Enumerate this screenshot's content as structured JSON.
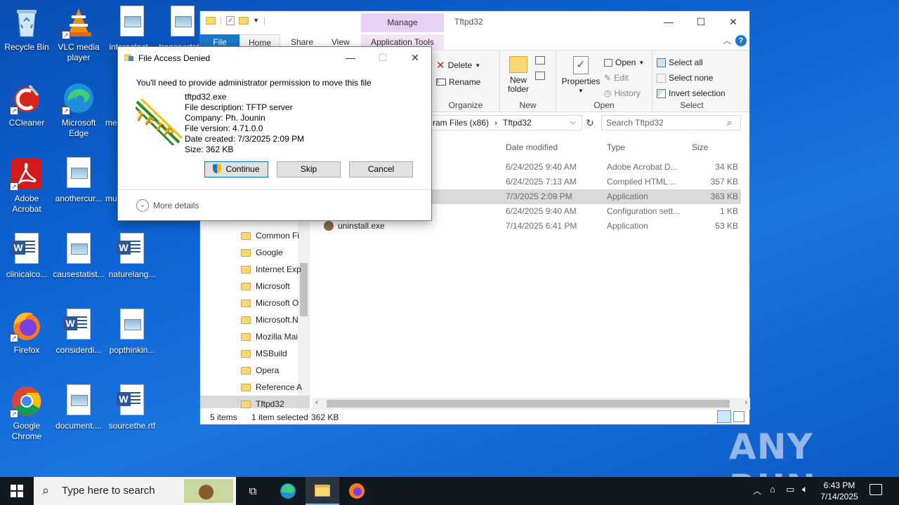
{
  "desktop": {
    "icons": [
      {
        "label": "Recycle Bin",
        "type": "recycle"
      },
      {
        "label": "VLC media player",
        "type": "vlc"
      },
      {
        "label": "interactact...",
        "type": "doc"
      },
      {
        "label": "transportat...",
        "type": "doc"
      },
      {
        "label": "CCleaner",
        "type": "ccleaner"
      },
      {
        "label": "Microsoft Edge",
        "type": "edge"
      },
      {
        "label": "me...",
        "type": "doc"
      },
      {
        "label": "Adobe Acrobat",
        "type": "acrobat"
      },
      {
        "label": "anothercur...",
        "type": "doc"
      },
      {
        "label": "mu...",
        "type": "doc"
      },
      {
        "label": "clinicalco...",
        "type": "word"
      },
      {
        "label": "causestatist...",
        "type": "doc"
      },
      {
        "label": "naturelang...",
        "type": "word"
      },
      {
        "label": "Firefox",
        "type": "firefox"
      },
      {
        "label": "considerdi...",
        "type": "word"
      },
      {
        "label": "popthinkin...",
        "type": "doc"
      },
      {
        "label": "Google Chrome",
        "type": "chrome"
      },
      {
        "label": "document....",
        "type": "doc"
      },
      {
        "label": "sourcethe.rtf",
        "type": "word"
      }
    ]
  },
  "explorer": {
    "title": "Tftpd32",
    "manage_tab": "Manage",
    "tabs": {
      "file": "File",
      "home": "Home",
      "share": "Share",
      "view": "View",
      "app_tools": "Application Tools"
    },
    "ribbon": {
      "delete": "Delete",
      "rename": "Rename",
      "organize": "Organize",
      "new_folder": "New folder",
      "new_group": "New",
      "properties": "Properties",
      "open": "Open",
      "edit": "Edit",
      "history": "History",
      "open_group": "Open",
      "select_all": "Select all",
      "select_none": "Select none",
      "invert_selection": "Invert selection",
      "select_group": "Select"
    },
    "address": {
      "path_partial": "ram Files (x86)",
      "current": "Tftpd32"
    },
    "search_placeholder": "Search Tftpd32",
    "columns": {
      "date": "Date modified",
      "type": "Type",
      "size": "Size"
    },
    "files": [
      {
        "name": "",
        "date": "6/24/2025 9:40 AM",
        "type": "Adobe Acrobat D...",
        "size": "34 KB",
        "selected": false
      },
      {
        "name": "",
        "date": "6/24/2025 7:13 AM",
        "type": "Compiled HTML ...",
        "size": "357 KB",
        "selected": false
      },
      {
        "name": "",
        "date": "7/3/2025 2:09 PM",
        "type": "Application",
        "size": "363 KB",
        "selected": true
      },
      {
        "name": "",
        "date": "6/24/2025 9:40 AM",
        "type": "Configuration sett...",
        "size": "1 KB",
        "selected": false
      },
      {
        "name": "uninstall.exe",
        "date": "7/14/2025 6:41 PM",
        "type": "Application",
        "size": "53 KB",
        "selected": false
      }
    ],
    "nav_items": [
      "Common Fi",
      "Google",
      "Internet Exp",
      "Microsoft",
      "Microsoft O",
      "Microsoft.N",
      "Mozilla Mai",
      "MSBuild",
      "Opera",
      "Reference A",
      "Tftpd32"
    ],
    "status": {
      "count": "5 items",
      "selected": "1 item selected",
      "size": "362 KB"
    }
  },
  "dialog": {
    "title": "File Access Denied",
    "message": "You'll need to provide administrator permission to move this file",
    "file_name": "tftpd32.exe",
    "description": "File description: TFTP server",
    "company": "Company: Ph. Jounin",
    "version": "File version: 4.71.0.0",
    "created": "Date created: 7/3/2025 2:09 PM",
    "size": "Size: 362 KB",
    "logo_text": "TFTP",
    "buttons": {
      "continue": "Continue",
      "skip": "Skip",
      "cancel": "Cancel"
    },
    "more_details": "More details"
  },
  "taskbar": {
    "search_placeholder": "Type here to search",
    "time": "6:43 PM",
    "date": "7/14/2025"
  },
  "watermark": "ANY RUN"
}
